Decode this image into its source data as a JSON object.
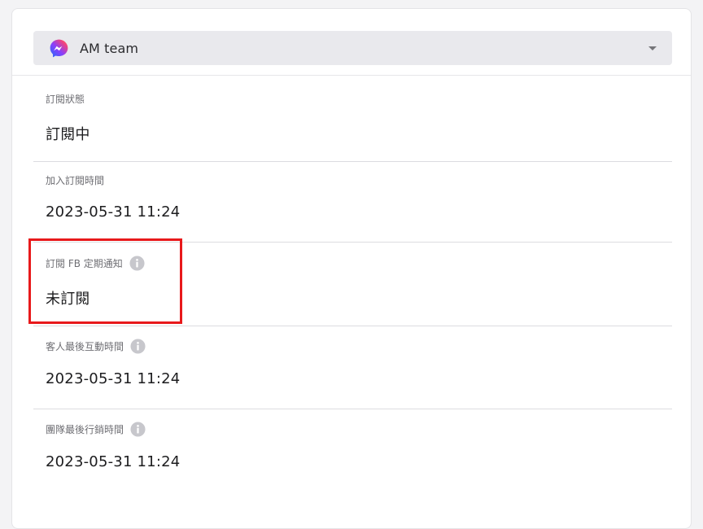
{
  "selector": {
    "label": "AM team",
    "icon": "messenger-icon"
  },
  "fields": [
    {
      "label": "訂閱狀態",
      "value": "訂閱中",
      "has_info": false
    },
    {
      "label": "加入訂閱時間",
      "value": "2023-05-31 11:24",
      "has_info": false
    },
    {
      "label": "訂閱 FB 定期通知",
      "value": "未訂閱",
      "has_info": true
    },
    {
      "label": "客人最後互動時間",
      "value": "2023-05-31 11:24",
      "has_info": true
    },
    {
      "label": "團隊最後行銷時間",
      "value": "2023-05-31 11:24",
      "has_info": true
    }
  ],
  "colors": {
    "highlight": "#e8191b",
    "selector_bg": "#e9e9ed",
    "info_icon": "#c7c7cc"
  }
}
